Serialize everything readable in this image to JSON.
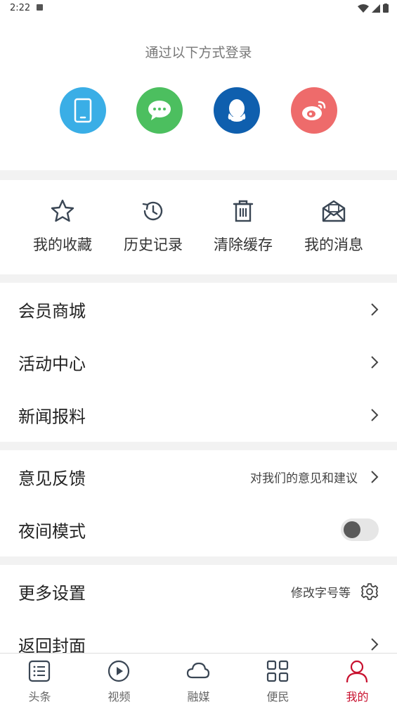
{
  "status": {
    "time": "2:22"
  },
  "login": {
    "title": "通过以下方式登录",
    "options": [
      {
        "icon": "phone-icon",
        "color": "#3aaee6"
      },
      {
        "icon": "wechat-icon",
        "color": "#4cbf5f"
      },
      {
        "icon": "qq-icon",
        "color": "#0f5fae"
      },
      {
        "icon": "weibo-icon",
        "color": "#ee6b6b"
      }
    ]
  },
  "quick": {
    "items": [
      {
        "label": "我的收藏",
        "icon": "star-icon"
      },
      {
        "label": "历史记录",
        "icon": "history-icon"
      },
      {
        "label": "清除缓存",
        "icon": "trash-icon"
      },
      {
        "label": "我的消息",
        "icon": "mail-icon"
      }
    ]
  },
  "menu": {
    "group1": [
      {
        "label": "会员商城"
      },
      {
        "label": "活动中心"
      },
      {
        "label": "新闻报料"
      }
    ],
    "feedback": {
      "label": "意见反馈",
      "hint": "对我们的意见和建议"
    },
    "night_mode": {
      "label": "夜间模式",
      "enabled": false
    },
    "more_settings": {
      "label": "更多设置",
      "hint": "修改字号等"
    },
    "back_cover": {
      "label": "返回封面"
    }
  },
  "tabbar": {
    "active_color": "#c8102e",
    "tabs": [
      {
        "label": "头条",
        "icon": "news-list-icon"
      },
      {
        "label": "视频",
        "icon": "play-icon"
      },
      {
        "label": "融媒",
        "icon": "cloud-icon"
      },
      {
        "label": "便民",
        "icon": "grid-icon"
      },
      {
        "label": "我的",
        "icon": "user-icon",
        "active": true
      }
    ]
  }
}
